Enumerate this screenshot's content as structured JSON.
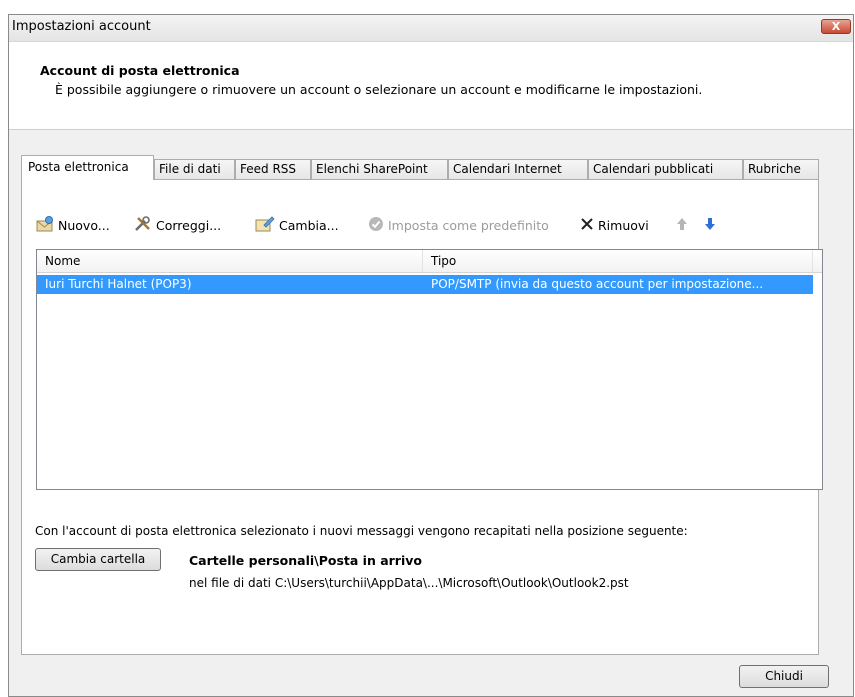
{
  "window": {
    "title": "Impostazioni account",
    "close_label": "X"
  },
  "header": {
    "title": "Account di posta elettronica",
    "subtitle": "È possibile aggiungere o rimuovere un account o selezionare un account e modificarne le impostazioni."
  },
  "tabs": [
    {
      "label": "Posta elettronica",
      "active": true
    },
    {
      "label": "File di dati"
    },
    {
      "label": "Feed RSS"
    },
    {
      "label": "Elenchi SharePoint"
    },
    {
      "label": "Calendari Internet"
    },
    {
      "label": "Calendari pubblicati"
    },
    {
      "label": "Rubriche"
    }
  ],
  "toolbar": {
    "new_label": "Nuovo...",
    "repair_label": "Correggi...",
    "change_label": "Cambia...",
    "default_label": "Imposta come predefinito",
    "remove_label": "Rimuovi"
  },
  "list": {
    "columns": [
      "Nome",
      "Tipo"
    ],
    "rows": [
      {
        "name": "Iuri Turchi Halnet (POP3)",
        "type": "POP/SMTP (invia da questo account per impostazione..."
      }
    ]
  },
  "delivery": {
    "info": "Con l'account di posta elettronica selezionato i nuovi messaggi vengono recapitati nella posizione seguente:",
    "change_folder_label": "Cambia cartella",
    "folder": "Cartelle personali\\Posta in arrivo",
    "path": "nel file di dati C:\\Users\\turchii\\AppData\\...\\Microsoft\\Outlook\\Outlook2.pst"
  },
  "footer": {
    "close_label": "Chiudi"
  }
}
